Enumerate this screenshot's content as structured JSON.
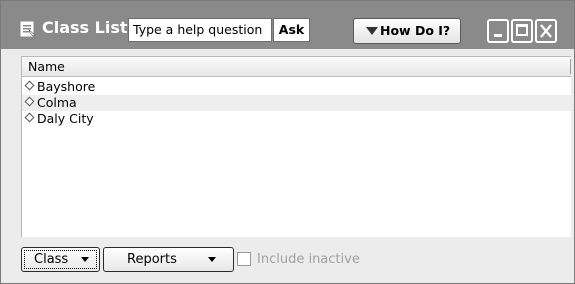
{
  "titlebar": {
    "title": "Class List",
    "help_placeholder": "Type a help question",
    "ask_label": "Ask",
    "how_do_i_label": "How Do I?"
  },
  "list": {
    "column_header": "Name",
    "rows": [
      {
        "name": "Bayshore"
      },
      {
        "name": "Colma"
      },
      {
        "name": "Daly City"
      }
    ]
  },
  "footer": {
    "class_button": "Class",
    "reports_button": "Reports",
    "include_inactive_label": "Include inactive",
    "include_inactive_checked": false
  },
  "colors": {
    "titlebar": "#8a8a8a",
    "window_bg": "#ececec",
    "alt_row": "#eeeeee"
  }
}
